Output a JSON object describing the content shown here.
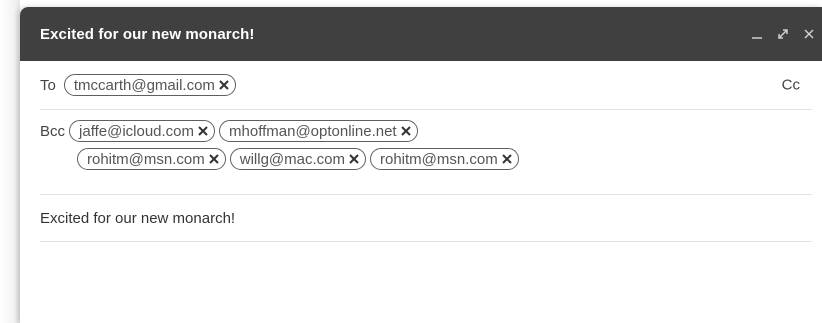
{
  "window": {
    "title": "Excited for our new monarch!",
    "controls": [
      "minimize-icon",
      "expand-icon",
      "close-icon"
    ]
  },
  "to": {
    "label": "To",
    "recipients": [
      "tmccarth@gmail.com"
    ],
    "cc_label": "Cc"
  },
  "bcc": {
    "label": "Bcc",
    "recipients": [
      "jaffe@icloud.com",
      "mhoffman@optonline.net",
      "rohitm@msn.com",
      "willg@mac.com",
      "rohitm@msn.com"
    ]
  },
  "subject": {
    "value": "Excited for our new monarch!"
  },
  "colors": {
    "titlebar_bg": "#404040",
    "titlebar_text": "#ffffff",
    "divider": "#e2e2e2",
    "chip_border": "#5f5f5f"
  }
}
